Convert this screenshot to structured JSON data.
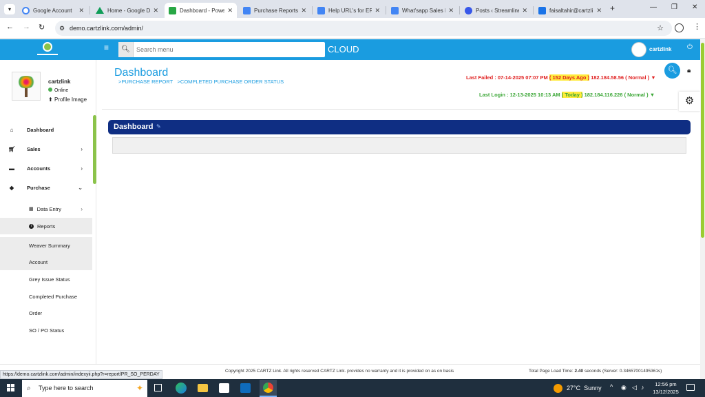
{
  "browser": {
    "tabs": [
      {
        "title": "Google Account",
        "favicon": "google-icon",
        "color": "#4285f4"
      },
      {
        "title": "Home - Google Dr",
        "favicon": "drive-icon",
        "color": "#0f9d58"
      },
      {
        "title": "Dashboard - Powe",
        "favicon": "cartz-icon",
        "color": "#28a745",
        "active": true
      },
      {
        "title": "Purchase Reports",
        "favicon": "docs-icon",
        "color": "#4285f4"
      },
      {
        "title": "Help URL's for ER",
        "favicon": "docs-icon",
        "color": "#4285f4"
      },
      {
        "title": "What'sapp Sales M",
        "favicon": "docs-icon",
        "color": "#4285f4"
      },
      {
        "title": "Posts ‹ Streamline",
        "favicon": "wordpress-icon",
        "color": "#3858e9"
      },
      {
        "title": "faisaltahir@cartzli",
        "favicon": "mail-icon",
        "color": "#1a73e8"
      }
    ],
    "url": "demo.cartzlink.com/admin/",
    "status_url": "https://demo.cartzlink.com/admin/indexyii.php?r=report/PR_SO_PERDAY"
  },
  "header": {
    "search_placeholder": "Search menu",
    "cloud_label": "CLOUD",
    "user_name": "cartzlink",
    "accent": "#1a9ce0"
  },
  "profile": {
    "name": "cartzlink",
    "status": "Online",
    "image_link": "Profile Image"
  },
  "nav": {
    "dashboard": "Dashboard",
    "sales": "Sales",
    "accounts": "Accounts",
    "purchase": "Purchase",
    "data_entry": "Data Entry",
    "reports": "Reports",
    "weaver_summary": "Weaver Summary",
    "account": "Account",
    "grey_issue_status": "Grey Issue Status",
    "completed_purchase": "Completed Purchase",
    "order": "Order",
    "so_po_status": "SO / PO Status"
  },
  "page": {
    "title": "Dashboard",
    "crumb1": ">PURCHASE REPORT",
    "crumb2": ">COMPLETED PURCHASE ORDER STATUS",
    "panel_title": "Dashboard"
  },
  "login_info": {
    "failed_prefix": "Last Failed : 07-14-2025 07:07 PM",
    "failed_ago": "( 152 Days Ago )",
    "failed_ip": "182.184.58.56",
    "failed_status": "( Normal )",
    "login_prefix": "Last Login : 12-13-2025 10:13 AM",
    "login_ago": "( Today )",
    "login_ip": "182.184.116.226",
    "login_status": "( Normal )"
  },
  "footer": {
    "copyright": "Copyright 2025 CARTZ Link. All rights reserved CARTZ Link. provides no warranty and it is provided on as on basis",
    "load_prefix": "Total Page Load Time:",
    "load_value": "2.40",
    "load_suffix": "seconds (Server: 0.34657001495361s)"
  },
  "taskbar": {
    "search_placeholder": "Type here to search",
    "weather_temp": "27°C",
    "weather_desc": "Sunny",
    "time": "12:56 pm",
    "date": "13/12/2025"
  }
}
